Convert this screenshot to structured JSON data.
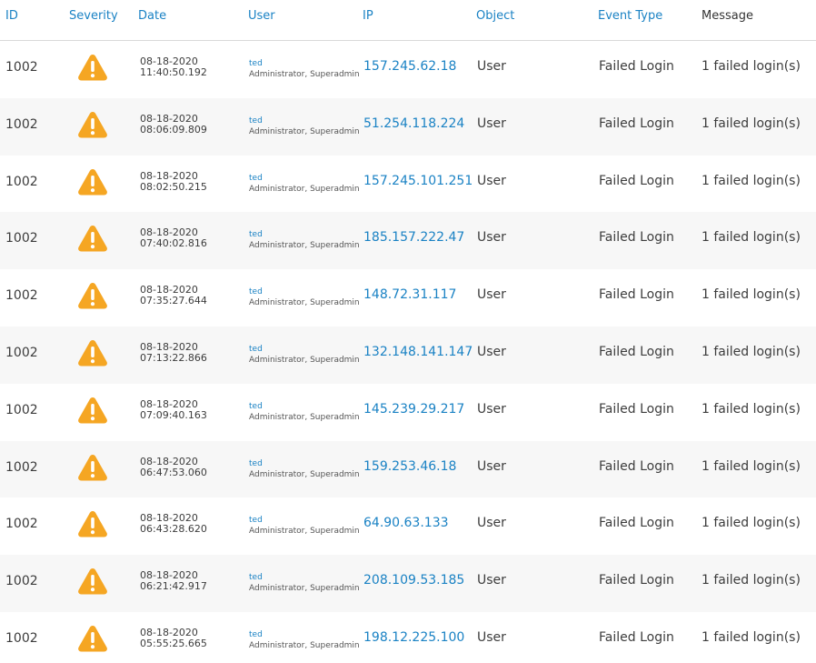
{
  "columns": {
    "id": "ID",
    "severity": "Severity",
    "date": "Date",
    "user": "User",
    "ip": "IP",
    "object": "Object",
    "event_type": "Event Type",
    "message": "Message"
  },
  "colors": {
    "link": "#1a82c4",
    "warning": "#f5a623",
    "stripe": "#f7f7f7"
  },
  "severity_icon": "warning-triangle-icon",
  "rows": [
    {
      "id": "1002",
      "date": "08-18-2020",
      "time": "11:40:50.192",
      "user": "ted",
      "roles": "Administrator, Superadmin",
      "ip": "157.245.62.18",
      "object": "User",
      "event_type": "Failed Login",
      "message": "1 failed login(s)"
    },
    {
      "id": "1002",
      "date": "08-18-2020",
      "time": "08:06:09.809",
      "user": "ted",
      "roles": "Administrator, Superadmin",
      "ip": "51.254.118.224",
      "object": "User",
      "event_type": "Failed Login",
      "message": "1 failed login(s)"
    },
    {
      "id": "1002",
      "date": "08-18-2020",
      "time": "08:02:50.215",
      "user": "ted",
      "roles": "Administrator, Superadmin",
      "ip": "157.245.101.251",
      "object": "User",
      "event_type": "Failed Login",
      "message": "1 failed login(s)"
    },
    {
      "id": "1002",
      "date": "08-18-2020",
      "time": "07:40:02.816",
      "user": "ted",
      "roles": "Administrator, Superadmin",
      "ip": "185.157.222.47",
      "object": "User",
      "event_type": "Failed Login",
      "message": "1 failed login(s)"
    },
    {
      "id": "1002",
      "date": "08-18-2020",
      "time": "07:35:27.644",
      "user": "ted",
      "roles": "Administrator, Superadmin",
      "ip": "148.72.31.117",
      "object": "User",
      "event_type": "Failed Login",
      "message": "1 failed login(s)"
    },
    {
      "id": "1002",
      "date": "08-18-2020",
      "time": "07:13:22.866",
      "user": "ted",
      "roles": "Administrator, Superadmin",
      "ip": "132.148.141.147",
      "object": "User",
      "event_type": "Failed Login",
      "message": "1 failed login(s)"
    },
    {
      "id": "1002",
      "date": "08-18-2020",
      "time": "07:09:40.163",
      "user": "ted",
      "roles": "Administrator, Superadmin",
      "ip": "145.239.29.217",
      "object": "User",
      "event_type": "Failed Login",
      "message": "1 failed login(s)"
    },
    {
      "id": "1002",
      "date": "08-18-2020",
      "time": "06:47:53.060",
      "user": "ted",
      "roles": "Administrator, Superadmin",
      "ip": "159.253.46.18",
      "object": "User",
      "event_type": "Failed Login",
      "message": "1 failed login(s)"
    },
    {
      "id": "1002",
      "date": "08-18-2020",
      "time": "06:43:28.620",
      "user": "ted",
      "roles": "Administrator, Superadmin",
      "ip": "64.90.63.133",
      "object": "User",
      "event_type": "Failed Login",
      "message": "1 failed login(s)"
    },
    {
      "id": "1002",
      "date": "08-18-2020",
      "time": "06:21:42.917",
      "user": "ted",
      "roles": "Administrator, Superadmin",
      "ip": "208.109.53.185",
      "object": "User",
      "event_type": "Failed Login",
      "message": "1 failed login(s)"
    },
    {
      "id": "1002",
      "date": "08-18-2020",
      "time": "05:55:25.665",
      "user": "ted",
      "roles": "Administrator, Superadmin",
      "ip": "198.12.225.100",
      "object": "User",
      "event_type": "Failed Login",
      "message": "1 failed login(s)"
    }
  ]
}
